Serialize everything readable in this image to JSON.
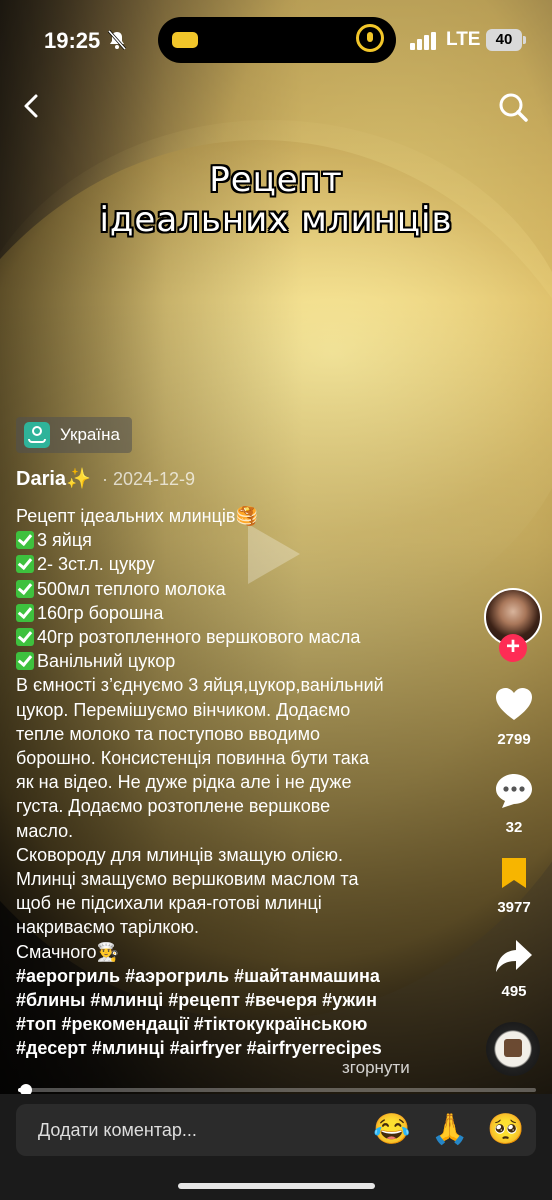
{
  "status_bar": {
    "time": "19:25",
    "network": "LTE",
    "battery": "40"
  },
  "video": {
    "title_lines": [
      "Рецепт",
      "ідеальних млинців"
    ],
    "progress": 0.015
  },
  "location": {
    "label": "Україна"
  },
  "author": {
    "name": "Daria✨",
    "date": "· 2024-12-9"
  },
  "caption": {
    "title": "Рецепт ідеальних млинців🥞",
    "ingredients": [
      "3 яйця",
      "2- 3ст.л. цукру",
      "500мл теплого молока",
      "160гр борошна",
      "40гр розтопленного вершкового масла",
      "Ванільний цукор"
    ],
    "body_lines": [
      "В ємності з’єднуємо 3 яйця,цукор,ванільний",
      "цукор. Перемішуємо вінчиком. Додаємо",
      "тепле молоко та поступово вводимо",
      "борошно. Консистенція повинна бути така",
      "як на відео. Не дуже рідка але і не дуже",
      "густа. Додаємо розтоплене вершкове",
      "масло.",
      "Сковороду для млинців змащую олією.",
      "Млинці змащуємо вершковим маслом та",
      "щоб не підсихали края-готові млинці",
      "накриваємо тарілкою.",
      "Смачного👨‍🍳"
    ],
    "hashtag_lines": [
      "#аерогриль #аэрогриль #шайтанмашина",
      "#блины #млинці #рецепт #вечеря #ужин",
      "#топ #рекомендації #тіктокукраїнською",
      "#десерт #млинці #airfryer #airfryerrecipes"
    ],
    "collapse_label": "згорнути"
  },
  "actions": {
    "likes": "2799",
    "comments": "32",
    "saves": "3977",
    "shares": "495"
  },
  "comment_bar": {
    "placeholder": "Додати коментар...",
    "emojis": [
      "😂",
      "🙏",
      "🥺"
    ]
  },
  "colors": {
    "follow": "#fe2c55",
    "save": "#f7b500",
    "check": "#3ec13e",
    "location_icon": "#2fb39a"
  }
}
